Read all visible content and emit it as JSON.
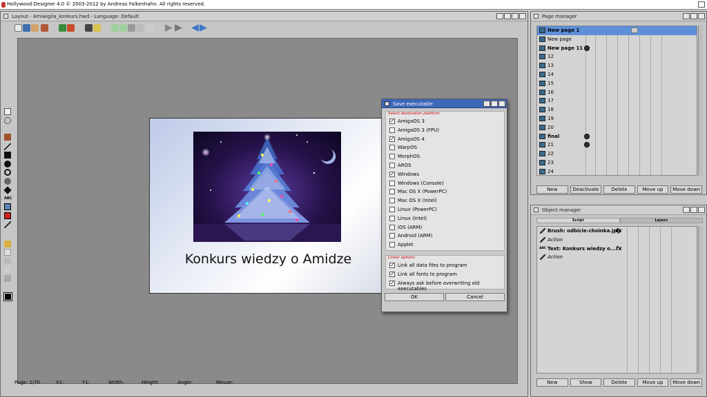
{
  "screen": {
    "title": "Hollywood Designer 4.0 © 2003-2012 by Andreas Falkenhahn. All rights reserved."
  },
  "layout_window": {
    "title": "Layout - Amiwiglia_konkurs.hwd - Language: Default",
    "slide_heading": "Konkurs wiedzy o Amidze",
    "status": {
      "page": "Page:  1/70",
      "x1": "X1:",
      "y1": "Y1:",
      "width": "Width:",
      "height": "Height:",
      "angle": "Angle:",
      "mouse": "Mouse:"
    }
  },
  "page_manager": {
    "title": "Page manager",
    "pages": [
      {
        "label": "New page 1",
        "bold": true,
        "selected": true,
        "marker": "right"
      },
      {
        "label": "New page",
        "bold": false
      },
      {
        "label": "New page 11",
        "bold": true,
        "marker": "script"
      },
      {
        "label": "12"
      },
      {
        "label": "13"
      },
      {
        "label": "14"
      },
      {
        "label": "15"
      },
      {
        "label": "16"
      },
      {
        "label": "17"
      },
      {
        "label": "18"
      },
      {
        "label": "19"
      },
      {
        "label": "20"
      },
      {
        "label": "final",
        "bold": true,
        "marker": "script"
      },
      {
        "label": "21",
        "marker": "script"
      },
      {
        "label": "22"
      },
      {
        "label": "23"
      },
      {
        "label": "24"
      }
    ],
    "buttons": [
      "New",
      "Deactivate",
      "Delete",
      "Move up",
      "Move down"
    ]
  },
  "object_manager": {
    "title": "Object manager",
    "tabs": [
      "Script",
      "Layers"
    ],
    "objects": [
      {
        "label": "Brush: odbicie-choinka.jpg",
        "bold": true,
        "fx": "fx",
        "icon": "brush-icon"
      },
      {
        "label": "Action",
        "italic": true,
        "icon": "brush-icon"
      },
      {
        "label": "Text: Konkurs wiedzy o...",
        "bold": true,
        "fx": "fx",
        "icon": "text-icon",
        "icon_text": "ABC"
      },
      {
        "label": "Action",
        "italic": true,
        "icon": "brush-icon"
      }
    ],
    "buttons": [
      "New",
      "Show",
      "Delete",
      "Move up",
      "Move down"
    ]
  },
  "dialog": {
    "title": "Save executable",
    "platform_group": "Select destination platform",
    "platforms": [
      {
        "label": "AmigaOS 3",
        "checked": true
      },
      {
        "label": "AmigaOS 3 (FPU)",
        "checked": false
      },
      {
        "label": "AmigaOS 4",
        "checked": true
      },
      {
        "label": "WarpOS",
        "checked": false
      },
      {
        "label": "MorphOS",
        "checked": false
      },
      {
        "label": "AROS",
        "checked": false
      },
      {
        "label": "Windows",
        "checked": true
      },
      {
        "label": "Windows (Console)",
        "checked": false
      },
      {
        "label": "Mac OS X (PowerPC)",
        "checked": false
      },
      {
        "label": "Mac OS X (Intel)",
        "checked": false
      },
      {
        "label": "Linux (PowerPC)",
        "checked": false
      },
      {
        "label": "Linux (Intel)",
        "checked": false
      },
      {
        "label": "iOS (ARM)",
        "checked": false
      },
      {
        "label": "Android (ARM)",
        "checked": false
      },
      {
        "label": "Applet",
        "checked": false
      }
    ],
    "linker_group": "Linker options",
    "linker": [
      {
        "label": "Link all data files to program",
        "checked": true
      },
      {
        "label": "Link all fonts to program",
        "checked": true
      },
      {
        "label": "Always ask before overwriting old executables",
        "checked": true
      }
    ],
    "ok": "OK",
    "cancel": "Cancel"
  },
  "colors": {
    "selection": "#5d8fd8",
    "dialog_title": "#3f67b8",
    "group_header": "#cc0000"
  }
}
